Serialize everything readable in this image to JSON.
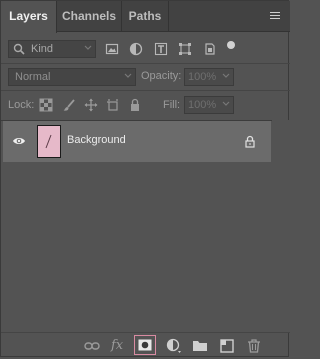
{
  "tabs": [
    {
      "label": "Layers",
      "active": true
    },
    {
      "label": "Channels",
      "active": false
    },
    {
      "label": "Paths",
      "active": false
    }
  ],
  "filter": {
    "kind_label": "Kind"
  },
  "blend": {
    "mode": "Normal",
    "opacity_label": "Opacity:",
    "opacity_value": "100%"
  },
  "lock": {
    "label": "Lock:",
    "fill_label": "Fill:",
    "fill_value": "100%"
  },
  "layers": [
    {
      "name": "Background",
      "visible": true,
      "locked": true,
      "thumb_color": "#e6b9c9"
    }
  ],
  "colors": {
    "panel_bg": "#535353",
    "tab_bg": "#424242",
    "selected_row": "#6b6b6b",
    "highlight": "#d98ba2"
  },
  "footer_icons": [
    "link-layers-icon",
    "layer-style-icon",
    "add-mask-icon",
    "adjustment-layer-icon",
    "new-group-icon",
    "new-layer-icon",
    "delete-layer-icon"
  ]
}
